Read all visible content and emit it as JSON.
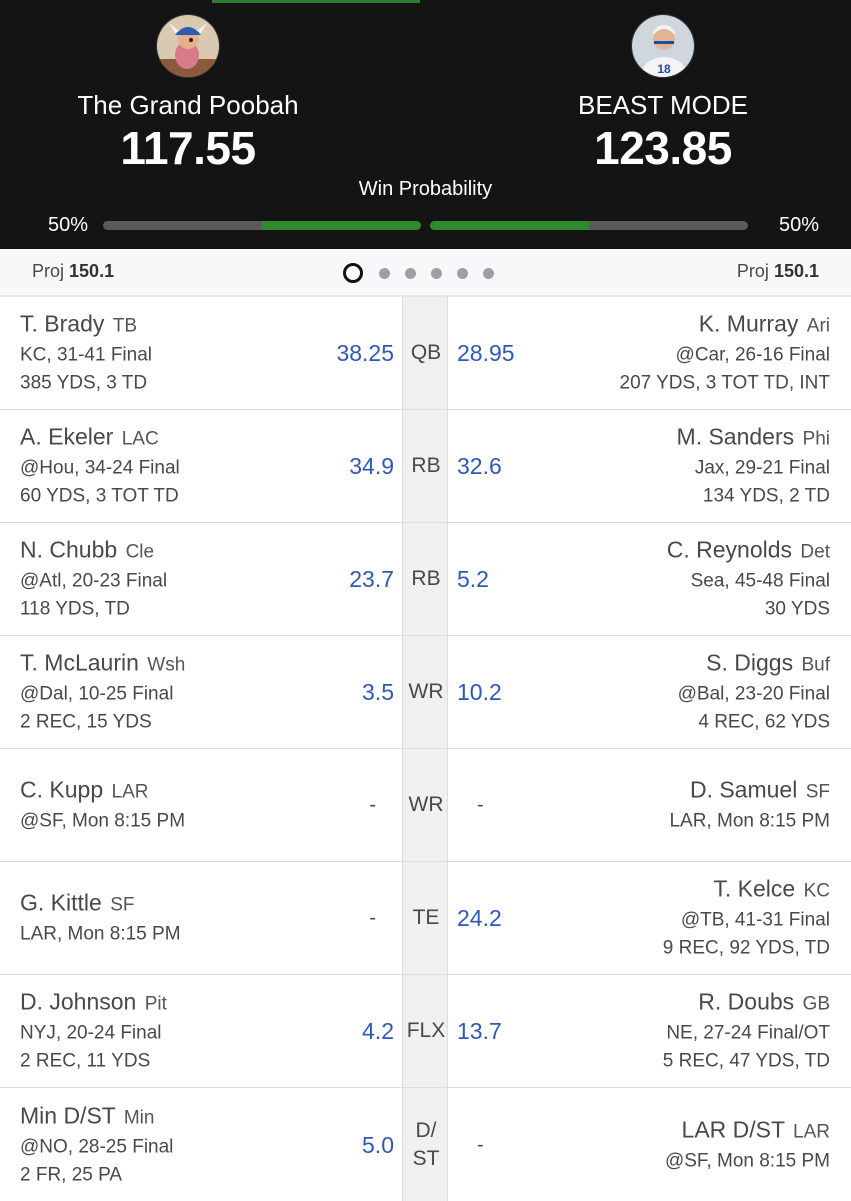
{
  "header": {
    "home": {
      "name": "The Grand Poobah",
      "score": "117.55",
      "win_pct": "50%",
      "win_fraction": 0.5
    },
    "away": {
      "name": "BEAST MODE",
      "score": "123.85",
      "win_pct": "50%",
      "win_fraction": 0.5
    },
    "win_probability_label": "Win Probability"
  },
  "proj": {
    "left_label": "Proj",
    "left_value": "150.1",
    "right_label": "Proj",
    "right_value": "150.1",
    "pages": 6,
    "active_page": 0
  },
  "rows": [
    {
      "pos": "QB",
      "left": {
        "name": "T. Brady",
        "team": "TB",
        "line1": "KC, 31-41 Final",
        "line2": "385 YDS, 3 TD",
        "score": "38.25"
      },
      "right": {
        "name": "K. Murray",
        "team": "Ari",
        "line1": "@Car, 26-16 Final",
        "line2": "207 YDS, 3 TOT TD, INT",
        "score": "28.95"
      }
    },
    {
      "pos": "RB",
      "left": {
        "name": "A. Ekeler",
        "team": "LAC",
        "line1": "@Hou, 34-24 Final",
        "line2": "60 YDS, 3 TOT TD",
        "score": "34.9"
      },
      "right": {
        "name": "M. Sanders",
        "team": "Phi",
        "line1": "Jax, 29-21 Final",
        "line2": "134 YDS, 2 TD",
        "score": "32.6"
      }
    },
    {
      "pos": "RB",
      "left": {
        "name": "N. Chubb",
        "team": "Cle",
        "line1": "@Atl, 20-23 Final",
        "line2": "118 YDS, TD",
        "score": "23.7"
      },
      "right": {
        "name": "C. Reynolds",
        "team": "Det",
        "line1": "Sea, 45-48 Final",
        "line2": "30 YDS",
        "score": "5.2"
      }
    },
    {
      "pos": "WR",
      "left": {
        "name": "T. McLaurin",
        "team": "Wsh",
        "line1": "@Dal, 10-25 Final",
        "line2": "2 REC, 15 YDS",
        "score": "3.5"
      },
      "right": {
        "name": "S. Diggs",
        "team": "Buf",
        "line1": "@Bal, 23-20 Final",
        "line2": "4 REC, 62 YDS",
        "score": "10.2"
      }
    },
    {
      "pos": "WR",
      "left": {
        "name": "C. Kupp",
        "team": "LAR",
        "line1": "@SF, Mon 8:15 PM",
        "line2": "",
        "score": "-"
      },
      "right": {
        "name": "D. Samuel",
        "team": "SF",
        "line1": "LAR, Mon 8:15 PM",
        "line2": "",
        "score": "-"
      }
    },
    {
      "pos": "TE",
      "left": {
        "name": "G. Kittle",
        "team": "SF",
        "line1": "LAR, Mon 8:15 PM",
        "line2": "",
        "score": "-"
      },
      "right": {
        "name": "T. Kelce",
        "team": "KC",
        "line1": "@TB, 41-31 Final",
        "line2": "9 REC, 92 YDS, TD",
        "score": "24.2"
      }
    },
    {
      "pos": "FLX",
      "left": {
        "name": "D. Johnson",
        "team": "Pit",
        "line1": "NYJ, 20-24 Final",
        "line2": "2 REC, 11 YDS",
        "score": "4.2"
      },
      "right": {
        "name": "R. Doubs",
        "team": "GB",
        "line1": "NE, 27-24 Final/OT",
        "line2": "5 REC, 47 YDS, TD",
        "score": "13.7"
      }
    },
    {
      "pos": "D/\nST",
      "left": {
        "name": "Min D/ST",
        "team": "Min",
        "line1": "@NO, 28-25 Final",
        "line2": "2 FR, 25 PA",
        "score": "5.0"
      },
      "right": {
        "name": "LAR D/ST",
        "team": "LAR",
        "line1": "@SF, Mon 8:15 PM",
        "line2": "",
        "score": "-"
      }
    }
  ]
}
